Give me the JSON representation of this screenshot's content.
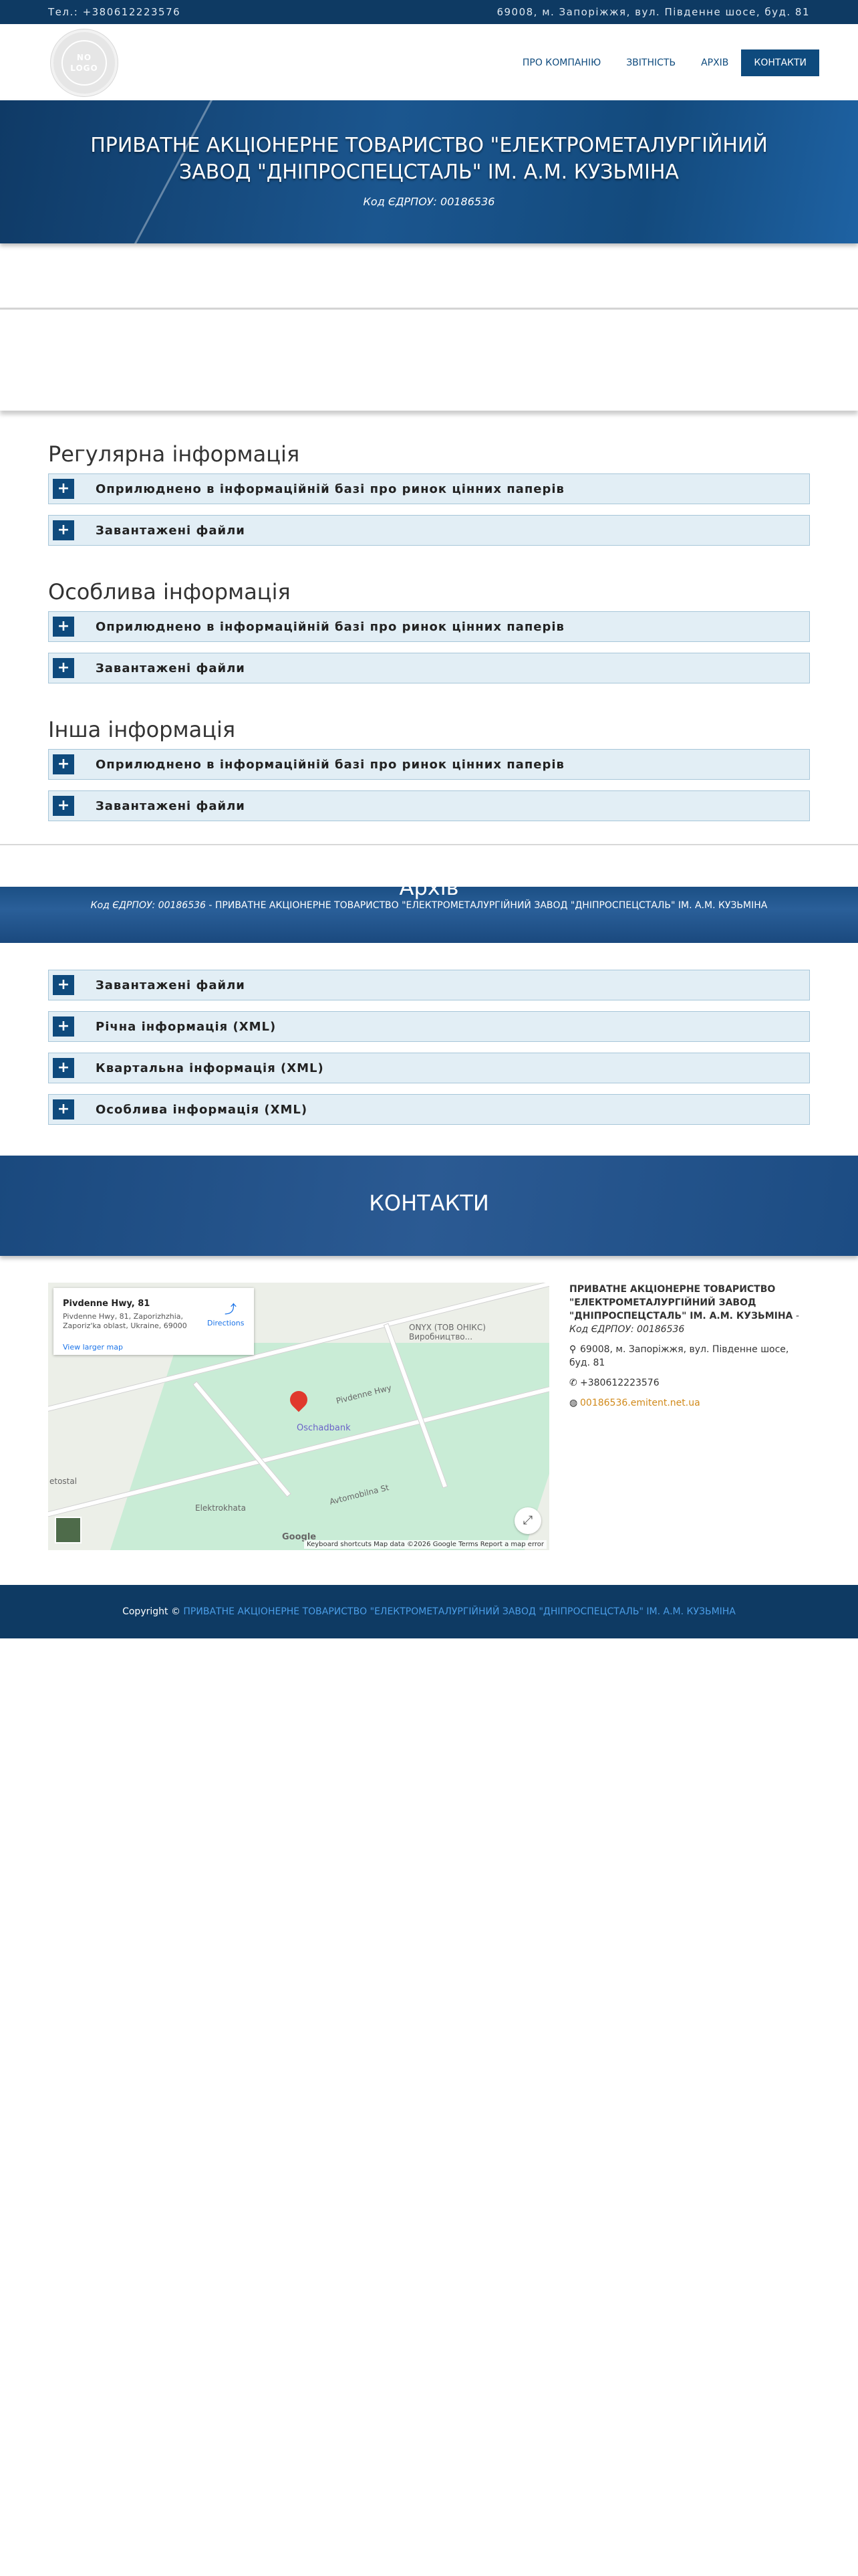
{
  "topbar": {
    "phone": "Тел.: +380612223576",
    "address": "69008, м. Запоріжжя, вул. Південне шосе, буд. 81"
  },
  "header": {
    "logo_text": "NO LOGO",
    "nav": [
      {
        "label": "ПРО КОМПАНІЮ",
        "active": false
      },
      {
        "label": "ЗВІТНІСТЬ",
        "active": false
      },
      {
        "label": "АРХІВ",
        "active": false
      },
      {
        "label": "КОНТАКТИ",
        "active": true
      }
    ]
  },
  "hero": {
    "title": "ПРИВАТНЕ АКЦІОНЕРНЕ ТОВАРИСТВО \"ЕЛЕКТРОМЕТАЛУРГІЙНИЙ ЗАВОД \"ДНІПРОСПЕЦСТАЛЬ\" ІМ. А.М. КУЗЬМІНА",
    "code": "Код ЄДРПОУ: 00186536"
  },
  "sections": [
    {
      "title": "Регулярна інформація",
      "items": [
        "Оприлюднено в інформаційній базі про ринок цінних паперів",
        "Завантажені файли"
      ]
    },
    {
      "title": "Особлива інформація",
      "items": [
        "Оприлюднено в інформаційній базі про ринок цінних паперів",
        "Завантажені файли"
      ]
    },
    {
      "title": "Інша інформація",
      "items": [
        "Оприлюднено в інформаційній базі про ринок цінних паперів",
        "Завантажені файли"
      ]
    }
  ],
  "archive": {
    "title": "Архів",
    "code": "Код ЄДРПОУ: 00186536",
    "company": " - ПРИВАТНЕ АКЦІОНЕРНЕ ТОВАРИСТВО \"ЕЛЕКТРОМЕТАЛУРГІЙНИЙ ЗАВОД \"ДНІПРОСПЕЦСТАЛЬ\" ІМ. А.М. КУЗЬМІНА",
    "items": [
      "Завантажені файли",
      "Річна інформація (XML)",
      "Квартальна інформація (XML)",
      "Особлива інформація (XML)"
    ]
  },
  "contacts": {
    "title": "КОНТАКТИ",
    "map": {
      "place": "Pivdenne Hwy, 81",
      "address": "Pivdenne Hwy, 81, Zaporizhzhia, Zaporiz'ka oblast, Ukraine, 69000",
      "directions": "Directions",
      "view_larger": "View larger map",
      "bank": "Oschadbank",
      "label_onyx": "ONYX (ТОВ ОНІКС) Виробництво...",
      "label_hwy": "Pivdenne Hwy",
      "label_avto": "Avtomobilna St",
      "label_elektro": "Elektrokhata",
      "label_metal": "etostal",
      "footer": "Keyboard shortcuts   Map data ©2026 Google   Terms   Report a map error",
      "google": "Google"
    },
    "org": "ПРИВАТНЕ АКЦІОНЕРНЕ ТОВАРИСТВО \"ЕЛЕКТРОМЕТАЛУРГІЙНИЙ ЗАВОД \"ДНІПРОСПЕЦСТАЛЬ\" ІМ. А.М. КУЗЬМІНА",
    "code": " - Код ЄДРПОУ: 00186536",
    "address": "69008, м. Запоріжжя, вул. Південне шосе, буд. 81",
    "phone": "+380612223576",
    "site": "00186536.emitent.net.ua"
  },
  "footer": {
    "copyright": "Copyright © ",
    "company": "ПРИВАТНЕ АКЦІОНЕРНЕ ТОВАРИСТВО \"ЕЛЕКТРОМЕТАЛУРГІЙНИЙ ЗАВОД \"ДНІПРОСПЕЦСТАЛЬ\" ІМ. А.М. КУЗЬМІНА"
  },
  "colors": {
    "primary": "#0e4a7d",
    "topbar": "#0e3a63",
    "accordion_bg": "#e2eef5",
    "link_orange": "#d18a1b"
  }
}
